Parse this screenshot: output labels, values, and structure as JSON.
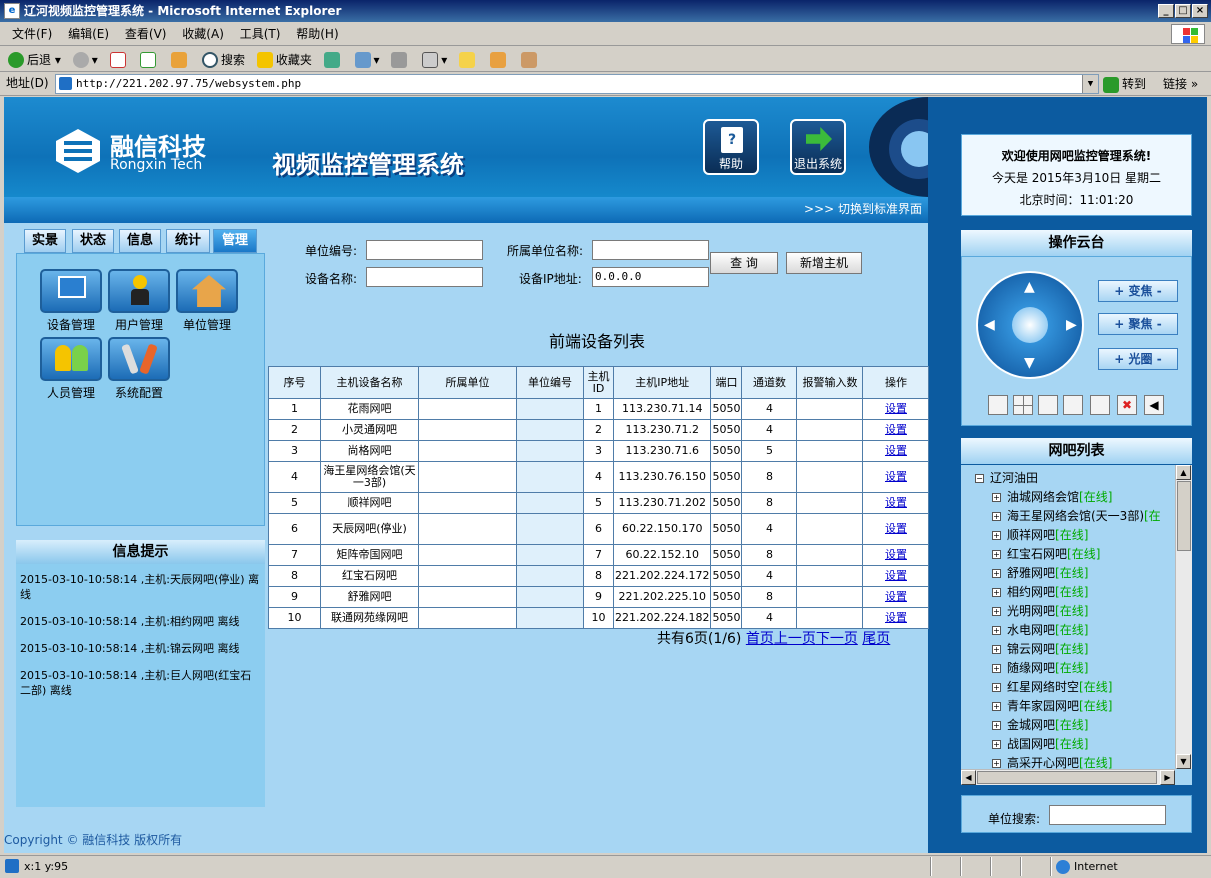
{
  "window": {
    "title": "辽河视频监控管理系统 - Microsoft Internet Explorer"
  },
  "menu": [
    "文件(F)",
    "编辑(E)",
    "查看(V)",
    "收藏(A)",
    "工具(T)",
    "帮助(H)"
  ],
  "toolbar": {
    "back": "后退",
    "search": "搜索",
    "favorites": "收藏夹"
  },
  "address": {
    "label": "地址(D)",
    "url": "http://221.202.97.75/websystem.php",
    "go": "转到",
    "links": "链接"
  },
  "header": {
    "logo_cn": "融信科技",
    "logo_en": "Rongxin Tech",
    "system_title": "视频监控管理系统",
    "help_label": "帮助",
    "exit_label": "退出系统",
    "switch_link": ">>> 切换到标准界面"
  },
  "tabs": [
    "实景",
    "状态",
    "信息",
    "统计",
    "管理"
  ],
  "mgmt_items": [
    "设备管理",
    "用户管理",
    "单位管理",
    "人员管理",
    "系统配置"
  ],
  "info": {
    "title": "信息提示",
    "messages": [
      "2015-03-10-10:58:14 ,主机:天辰网吧(停业) 离线",
      "2015-03-10-10:58:14 ,主机:相约网吧 离线",
      "2015-03-10-10:58:14 ,主机:锦云网吧 离线",
      "2015-03-10-10:58:14 ,主机:巨人网吧(红宝石二部) 离线"
    ]
  },
  "form": {
    "unit_no_label": "单位编号:",
    "unit_name_label": "所属单位名称:",
    "device_name_label": "设备名称:",
    "ip_label": "设备IP地址:",
    "ip_value": "0.0.0.0",
    "query_btn": "查 询",
    "add_btn": "新增主机"
  },
  "device_list": {
    "title": "前端设备列表",
    "headers": [
      "序号",
      "主机设备名称",
      "所属单位",
      "单位编号",
      "主机ID",
      "主机IP地址",
      "端口",
      "通道数",
      "报警输入数",
      "操作"
    ],
    "rows": [
      {
        "no": "1",
        "name": "花雨网吧",
        "ip": "113.230.71.14",
        "port": "5050",
        "ch": "4",
        "op": "设置"
      },
      {
        "no": "2",
        "name": "小灵通网吧",
        "ip": "113.230.71.2",
        "port": "5050",
        "ch": "4",
        "op": "设置"
      },
      {
        "no": "3",
        "name": "尚格网吧",
        "ip": "113.230.71.6",
        "port": "5050",
        "ch": "5",
        "op": "设置"
      },
      {
        "no": "4",
        "name": "海王星网络会馆(天一3部)",
        "ip": "113.230.76.150",
        "port": "5050",
        "ch": "8",
        "op": "设置"
      },
      {
        "no": "5",
        "name": "顺祥网吧",
        "ip": "113.230.71.202",
        "port": "5050",
        "ch": "8",
        "op": "设置"
      },
      {
        "no": "6",
        "name": "天辰网吧(停业)",
        "ip": "60.22.150.170",
        "port": "5050",
        "ch": "4",
        "op": "设置"
      },
      {
        "no": "7",
        "name": "矩阵帝国网吧",
        "ip": "60.22.152.10",
        "port": "5050",
        "ch": "8",
        "op": "设置"
      },
      {
        "no": "8",
        "name": "红宝石网吧",
        "ip": "221.202.224.172",
        "port": "5050",
        "ch": "4",
        "op": "设置"
      },
      {
        "no": "9",
        "name": "舒雅网吧",
        "ip": "221.202.225.10",
        "port": "5050",
        "ch": "8",
        "op": "设置"
      },
      {
        "no": "10",
        "name": "联通网苑缘网吧",
        "ip": "221.202.224.182",
        "port": "5050",
        "ch": "4",
        "op": "设置"
      }
    ]
  },
  "pager": {
    "summary": "共有6页(1/6)",
    "first": "首页",
    "prev": "上一页",
    "next": "下一页",
    "last": "尾页"
  },
  "welcome": {
    "text": "欢迎使用网吧监控管理系统!",
    "date": "今天是 2015年3月10日 星期二",
    "time": "北京时间：11:01:20"
  },
  "ptz": {
    "title": "操作云台",
    "zoom": "+ 变焦 -",
    "focus": "+ 聚焦 -",
    "iris": "+ 光圈 -"
  },
  "cafe_list": {
    "title": "网吧列表",
    "root": "辽河油田",
    "status_online": "[在线]",
    "items": [
      {
        "name": "油城网络会馆",
        "status": "[在线]"
      },
      {
        "name": "海王星网络会馆(天一3部)",
        "status": "[在"
      },
      {
        "name": "顺祥网吧",
        "status": "[在线]"
      },
      {
        "name": "红宝石网吧",
        "status": "[在线]"
      },
      {
        "name": "舒雅网吧",
        "status": "[在线]"
      },
      {
        "name": "相约网吧",
        "status": "[在线]"
      },
      {
        "name": "光明网吧",
        "status": "[在线]"
      },
      {
        "name": "水电网吧",
        "status": "[在线]"
      },
      {
        "name": "锦云网吧",
        "status": "[在线]"
      },
      {
        "name": "随缘网吧",
        "status": "[在线]"
      },
      {
        "name": "红星网络时空",
        "status": "[在线]"
      },
      {
        "name": "青年家园网吧",
        "status": "[在线]"
      },
      {
        "name": "金城网吧",
        "status": "[在线]"
      },
      {
        "name": "战国网吧",
        "status": "[在线]"
      },
      {
        "name": "高采开心网吧",
        "status": "[在线]"
      }
    ],
    "search_label": "单位搜索:"
  },
  "footer": {
    "copyright": "Copyright © 融信科技  版权所有"
  },
  "status": {
    "coords": "x:1 y:95",
    "zone": "Internet"
  },
  "colors": {
    "online": "#00aa00",
    "link": "#0000cc"
  }
}
